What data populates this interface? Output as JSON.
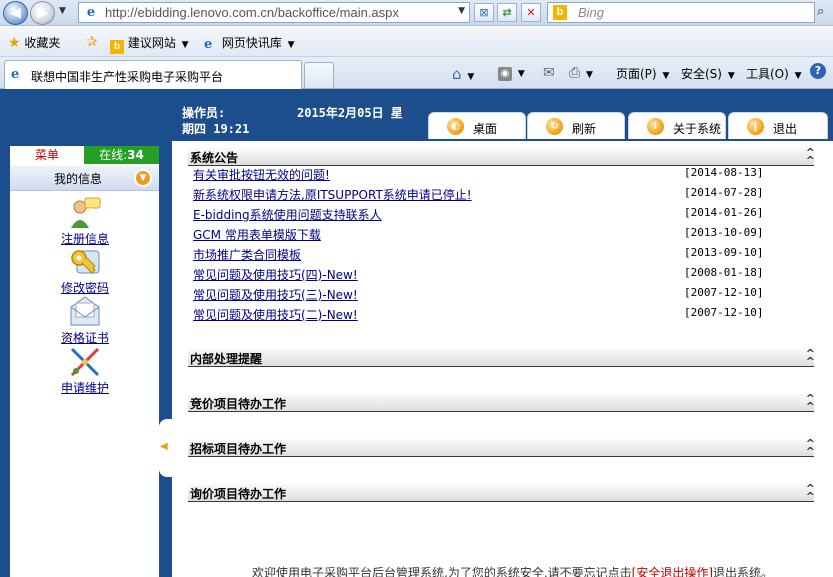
{
  "browser": {
    "url": "http://ebidding.lenovo.com.cn/backoffice/main.aspx",
    "search_placeholder": "Bing",
    "favorites": {
      "favorites_label": "收藏夹",
      "suggested_sites_label": "建议网站",
      "web_slices_label": "网页快讯库"
    },
    "tab_title": "联想中国非生产性采购电子采购平台",
    "commands": {
      "page_label": "页面(P)",
      "safety_label": "安全(S)",
      "tools_label": "工具(O)"
    }
  },
  "header": {
    "operator_label": "操作员:",
    "date": "2015年2月05日 星",
    "time": "期四 19:21"
  },
  "tabs": [
    {
      "label": "桌面"
    },
    {
      "label": "刷新"
    },
    {
      "label": "关于系统"
    },
    {
      "label": "退出"
    }
  ],
  "sidebar": {
    "menu_label": "菜单",
    "online_label": "在线:",
    "online_count": "34",
    "my_info_label": "我的信息",
    "items": [
      {
        "label": "注册信息",
        "icon": "user-icon"
      },
      {
        "label": "修改密码",
        "icon": "key-icon"
      },
      {
        "label": "资格证书",
        "icon": "envelope-icon"
      },
      {
        "label": "申请维护",
        "icon": "tools-icon"
      }
    ]
  },
  "sections": {
    "announcements": {
      "title": "系统公告",
      "items": [
        {
          "title": "有关审批按钮无效的问题!",
          "date": "[2014-08-13]"
        },
        {
          "title": "新系统权限申请方法,原ITSUPPORT系统申请已停止!",
          "date": "[2014-07-28]"
        },
        {
          "title": "E-bidding系统使用问题支持联系人",
          "date": "[2014-01-26]"
        },
        {
          "title": "GCM 常用表单模版下载",
          "date": "[2013-10-09]"
        },
        {
          "title": "市场推广类合同模板",
          "date": "[2013-09-10]"
        },
        {
          "title": "常见问题及使用技巧(四)-New!",
          "date": "[2008-01-18]"
        },
        {
          "title": "常见问题及使用技巧(三)-New!",
          "date": "[2007-12-10]"
        },
        {
          "title": "常见问题及使用技巧(二)-New!",
          "date": "[2007-12-10]"
        }
      ]
    },
    "internal_reminders": {
      "title": "内部处理提醒"
    },
    "auction_pending": {
      "title": "竞价项目待办工作"
    },
    "tender_pending": {
      "title": "招标项目待办工作"
    },
    "inquiry_pending": {
      "title": "询价项目待办工作"
    }
  },
  "footer": {
    "text_before": "欢迎使用电子采购平台后台管理系统,为了您的系统安全,请不要忘记点击",
    "highlight": "[安全退出操作]",
    "text_after": "退出系统。"
  }
}
